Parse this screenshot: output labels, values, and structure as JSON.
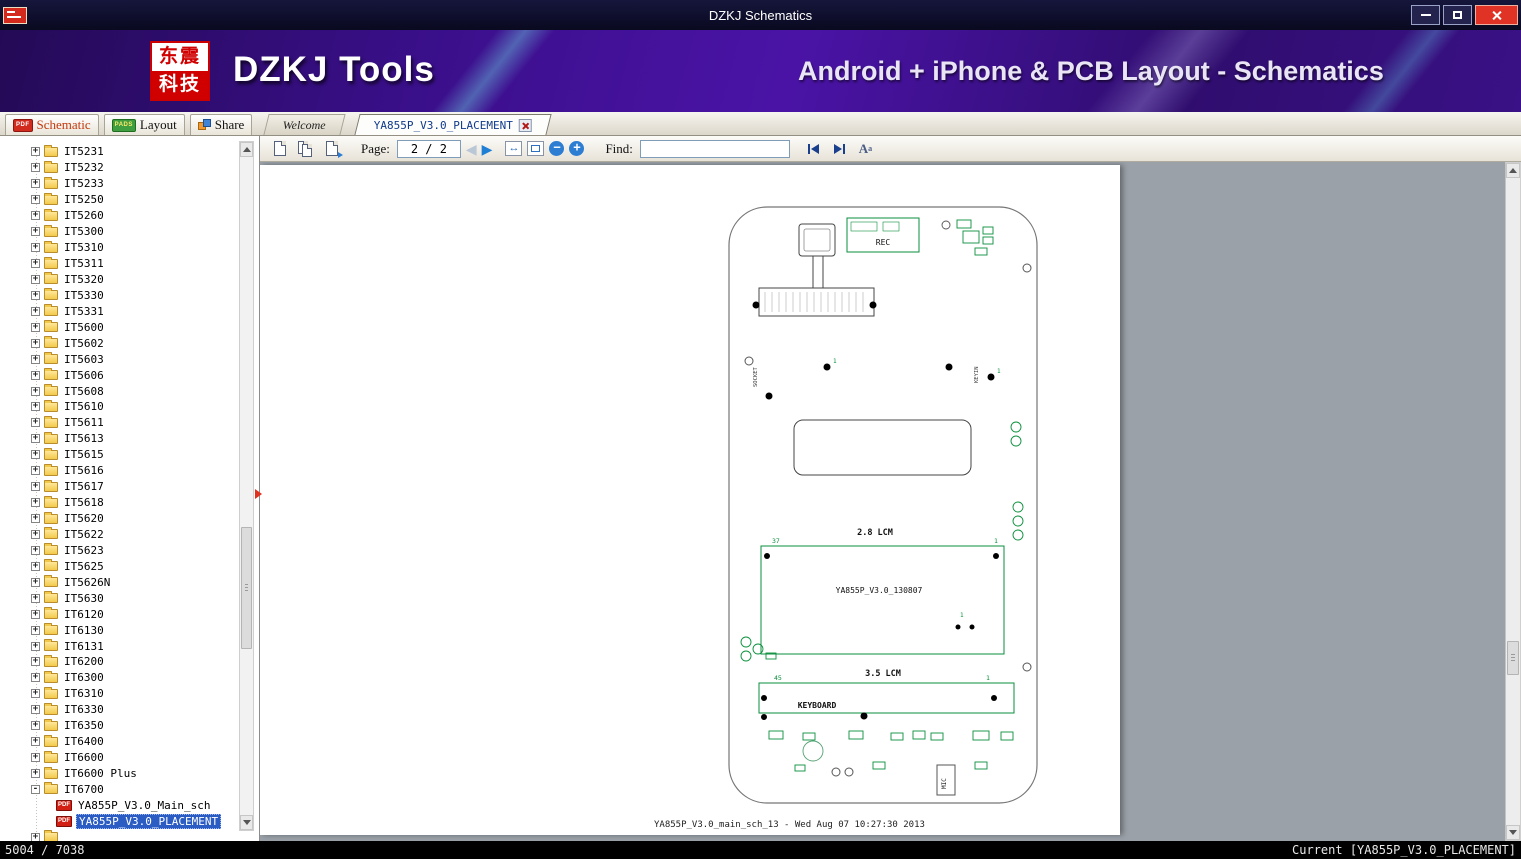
{
  "window": {
    "title": "DZKJ Schematics"
  },
  "banner": {
    "logo_line1": "东震",
    "logo_line2": "科技",
    "app_name": "DZKJ Tools",
    "subtitle": "Android + iPhone & PCB Layout - Schematics"
  },
  "ribbon_tabs": [
    {
      "label": "Schematic",
      "icon": "pdf-badge",
      "badge": "PDF"
    },
    {
      "label": "Layout",
      "icon": "pads-badge",
      "badge": "PADS"
    },
    {
      "label": "Share",
      "icon": "share-badge"
    }
  ],
  "doc_tabs": [
    {
      "label": "Welcome",
      "active": false
    },
    {
      "label": "YA855P_V3.0_PLACEMENT",
      "active": true
    }
  ],
  "toolbar": {
    "page_label": "Page:",
    "page_display": "2 / 2",
    "find_label": "Find:",
    "find_value": ""
  },
  "sidebar": {
    "folders": [
      {
        "label": "IT5231"
      },
      {
        "label": "IT5232"
      },
      {
        "label": "IT5233"
      },
      {
        "label": "IT5250"
      },
      {
        "label": "IT5260"
      },
      {
        "label": "IT5300"
      },
      {
        "label": "IT5310"
      },
      {
        "label": "IT5311"
      },
      {
        "label": "IT5320"
      },
      {
        "label": "IT5330"
      },
      {
        "label": "IT5331"
      },
      {
        "label": "IT5600"
      },
      {
        "label": "IT5602"
      },
      {
        "label": "IT5603"
      },
      {
        "label": "IT5606"
      },
      {
        "label": "IT5608"
      },
      {
        "label": "IT5610"
      },
      {
        "label": "IT5611"
      },
      {
        "label": "IT5613"
      },
      {
        "label": "IT5615"
      },
      {
        "label": "IT5616"
      },
      {
        "label": "IT5617"
      },
      {
        "label": "IT5618"
      },
      {
        "label": "IT5620"
      },
      {
        "label": "IT5622"
      },
      {
        "label": "IT5623"
      },
      {
        "label": "IT5625"
      },
      {
        "label": "IT5626N"
      },
      {
        "label": "IT5630"
      },
      {
        "label": "IT6120"
      },
      {
        "label": "IT6130"
      },
      {
        "label": "IT6131"
      },
      {
        "label": "IT6200"
      },
      {
        "label": "IT6300"
      },
      {
        "label": "IT6310"
      },
      {
        "label": "IT6330"
      },
      {
        "label": "IT6350"
      },
      {
        "label": "IT6400"
      },
      {
        "label": "IT6600"
      },
      {
        "label": "IT6600 Plus"
      },
      {
        "label": "IT6700",
        "expanded": true,
        "children": [
          {
            "label": "YA855P_V3.0_Main_sch"
          },
          {
            "label": "YA855P_V3.0_PLACEMENT",
            "selected": true
          }
        ]
      },
      {
        "label": ""
      }
    ]
  },
  "drawing": {
    "rec": "REC",
    "socket": "SOCKET",
    "keyin": "KEYIN",
    "pin1": "1",
    "lcm28_title": "2.8 LCM",
    "lcm28_first_pin": "37",
    "lcm28_last_pin": "1",
    "board_id": "YA855P_V3.0_130807",
    "lcm35_title": "3.5 LCM",
    "lcm35_first_pin": "45",
    "lcm35_last_pin": "1",
    "keyboard": "KEYBOARD",
    "mic": "MIC",
    "footer": "YA855P_V3.0_main_sch_13 - Wed Aug 07 10:27:30 2013"
  },
  "statusbar": {
    "left": "5004 / 7038",
    "right": "Current [YA855P_V3.0_PLACEMENT]"
  }
}
